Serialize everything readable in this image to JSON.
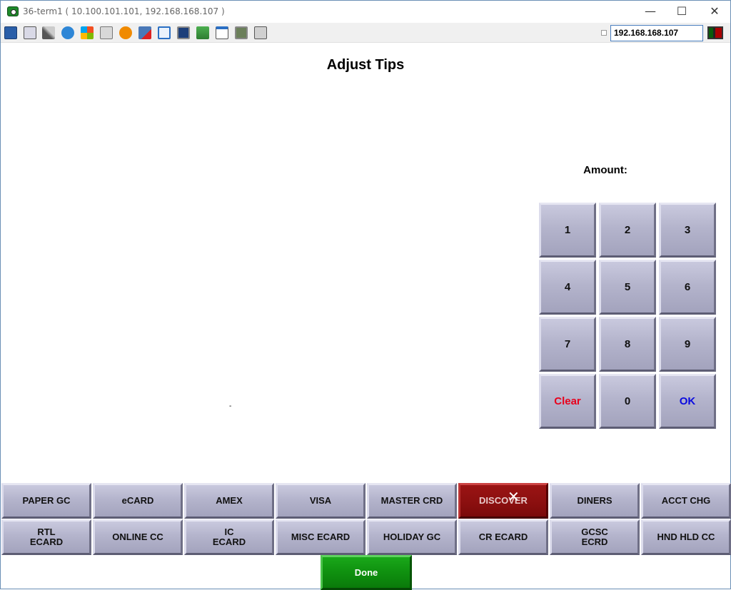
{
  "window": {
    "title": "36-term1 ( 10.100.101.101, 192.168.168.107 )",
    "controls": {
      "minimize": "—",
      "maximize": "☐",
      "close": "✕"
    }
  },
  "toolbar": {
    "icons": [
      "monitor-icon",
      "windows-icon",
      "tools-icon",
      "refresh-icon",
      "flag-icon",
      "keyboard-icon",
      "alert-icon",
      "disconnect-icon",
      "fullscreen-icon",
      "screen-icon",
      "download-icon",
      "notepad-icon",
      "image-icon",
      "chat-icon"
    ],
    "ip_address": "192.168.168.107"
  },
  "page": {
    "title": "Adjust Tips",
    "amount_label": "Amount:",
    "dash": "-"
  },
  "keypad": {
    "keys": [
      "1",
      "2",
      "3",
      "4",
      "5",
      "6",
      "7",
      "8",
      "9",
      "Clear",
      "0",
      "OK"
    ],
    "colors": {
      "clear": "#e8001c",
      "ok": "#0a0adf"
    }
  },
  "tenders": {
    "row1": [
      "PAPER GC",
      "eCARD",
      "AMEX",
      "VISA",
      "MASTER CRD",
      "DISCOVER",
      "DINERS",
      "ACCT CHG"
    ],
    "row2": [
      "RTL\nECARD",
      "ONLINE CC",
      "IC\nECARD",
      "MISC ECARD",
      "HOLIDAY GC",
      "CR ECARD",
      "GCSC\nECRD",
      "HND HLD CC"
    ],
    "selected": "DISCOVER",
    "selected_color": "#8a0f0f"
  },
  "done_label": "Done"
}
